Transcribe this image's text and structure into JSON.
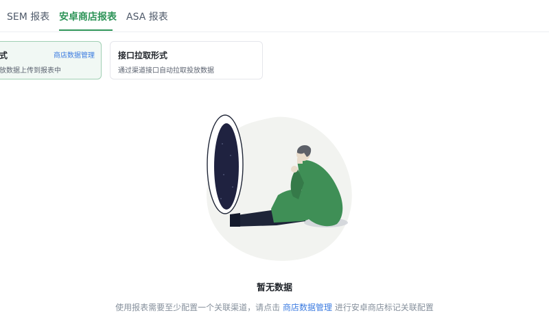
{
  "tabs": [
    {
      "label": "SEM 报表",
      "active": false
    },
    {
      "label": "安卓商店报表",
      "active": true
    },
    {
      "label": "ASA 报表",
      "active": false
    }
  ],
  "cards": {
    "manual": {
      "title": "式",
      "description": "放数据上传到报表中",
      "link": "商店数据管理"
    },
    "api": {
      "title": "接口拉取形式",
      "description": "通过渠道接口自动拉取投放数据"
    }
  },
  "empty_state": {
    "title": "暂无数据",
    "description_prefix": "使用报表需要至少配置一个关联渠道，请点击",
    "description_link": "商店数据管理",
    "description_suffix": "进行安卓商店标记关联配置"
  },
  "colors": {
    "accent_green": "#2e9458",
    "link_blue": "#3b7be0"
  }
}
